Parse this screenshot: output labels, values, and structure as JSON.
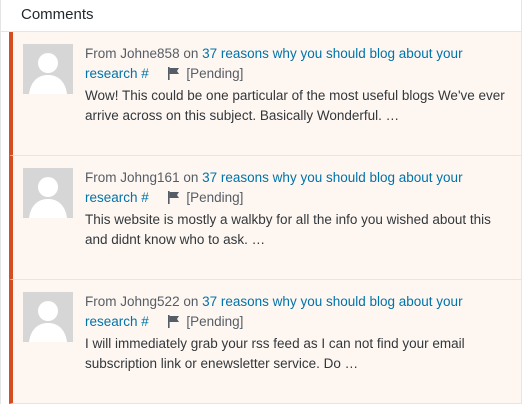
{
  "header": {
    "title": "Comments"
  },
  "comments": [
    {
      "from_label": "From",
      "author": "Johne858",
      "on_label": "on",
      "post_title": "37 reasons why you should blog about your research",
      "permalink": "#",
      "status": "[Pending]",
      "excerpt": "Wow! This could be one particular of the most useful blogs We've ever arrive across on this subject. Basically Wonderful. …"
    },
    {
      "from_label": "From",
      "author": "Johng161",
      "on_label": "on",
      "post_title": "37 reasons why you should blog about your research",
      "permalink": "#",
      "status": "[Pending]",
      "excerpt": "This website is mostly a walkby for all the info you wished about this and didnt know who to ask. …"
    },
    {
      "from_label": "From",
      "author": "Johng522",
      "on_label": "on",
      "post_title": "37 reasons why you should blog about your research",
      "permalink": "#",
      "status": "[Pending]",
      "excerpt": "I will immediately grab your rss feed as I can not find your email subscription link or enewsletter service. Do …"
    }
  ],
  "icons": {
    "avatar": "default-avatar-icon",
    "flag": "flag-icon"
  },
  "colors": {
    "pending_border": "#d54e21",
    "pending_bg": "#fef7f1",
    "link": "#0073aa"
  }
}
